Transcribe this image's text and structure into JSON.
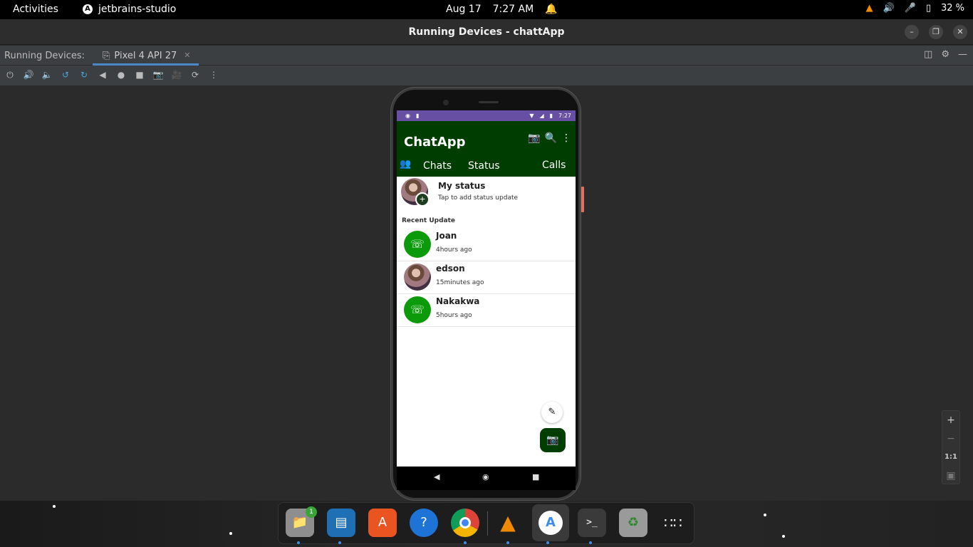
{
  "topbar": {
    "activities": "Activities",
    "app_name": "jetbrains-studio",
    "date": "Aug 17",
    "time": "7:27 AM",
    "battery": "32 %"
  },
  "window": {
    "title": "Running Devices - chattApp"
  },
  "tool_window": {
    "label": "Running Devices:",
    "device_tab": "Pixel 4 API 27"
  },
  "phone": {
    "status_time": "7:27",
    "app_title": "ChatApp",
    "tabs": [
      "Chats",
      "Status",
      "Calls"
    ],
    "my_status": {
      "name": "My status",
      "subtitle": "Tap to add status update"
    },
    "recent_label": "Recent Update",
    "updates": [
      {
        "name": "Joan",
        "time": "4hours ago",
        "avatar": "whatsapp-icon"
      },
      {
        "name": "edson",
        "time": "15minutes ago",
        "avatar": "photo"
      },
      {
        "name": "Nakakwa",
        "time": "5hours ago",
        "avatar": "whatsapp-icon"
      }
    ]
  },
  "zoom": {
    "plus": "+",
    "minus": "−",
    "actual_size": "1:1"
  },
  "dock": {
    "files_badge": "1",
    "apps": [
      "files-icon",
      "writer-icon",
      "software-store-icon",
      "help-icon",
      "chrome-icon",
      "vlc-icon",
      "android-studio-icon",
      "terminal-icon",
      "trash-icon",
      "app-grid-icon"
    ]
  },
  "colors": {
    "app_bar": "#003d00",
    "status_bar": "#6750a4",
    "whatsapp_green": "#0a9a0a"
  }
}
